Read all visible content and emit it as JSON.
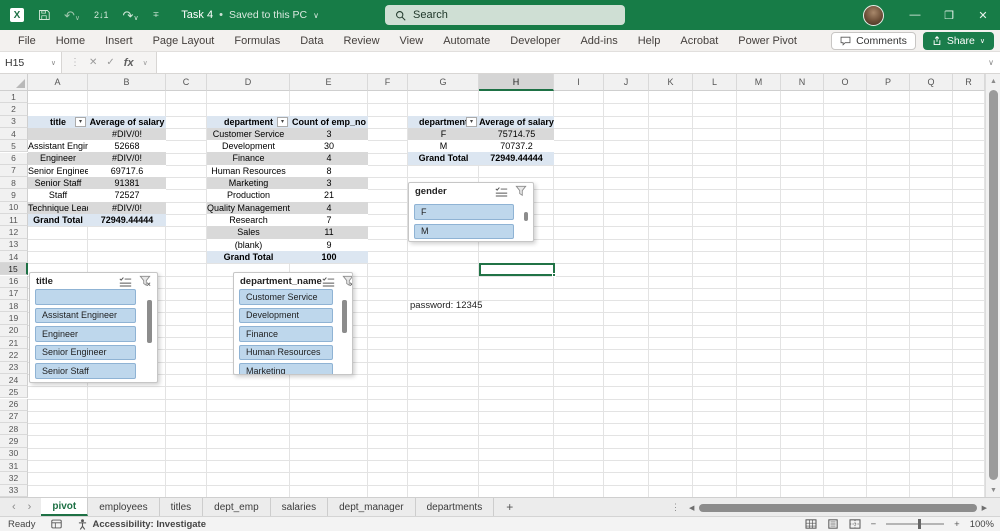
{
  "titlebar": {
    "doc_title": "Task 4",
    "separator": "•",
    "saved_status": "Saved to this PC",
    "search_placeholder": "Search"
  },
  "ribbon": {
    "tabs": [
      "File",
      "Home",
      "Insert",
      "Page Layout",
      "Formulas",
      "Data",
      "Review",
      "View",
      "Automate",
      "Developer",
      "Add-ins",
      "Help",
      "Acrobat",
      "Power Pivot"
    ],
    "comments_label": "Comments",
    "share_label": "Share"
  },
  "formula_bar": {
    "name_box": "H15",
    "fx_label": "fx"
  },
  "grid": {
    "columns": [
      "A",
      "B",
      "C",
      "D",
      "E",
      "F",
      "G",
      "H",
      "I",
      "J",
      "K",
      "L",
      "M",
      "N",
      "O",
      "P",
      "Q",
      "R"
    ],
    "rows": [
      "1",
      "2",
      "3",
      "4",
      "5",
      "6",
      "7",
      "8",
      "9",
      "10",
      "11",
      "12",
      "13",
      "14",
      "15",
      "16",
      "17",
      "18",
      "19",
      "20",
      "21",
      "22",
      "23",
      "24",
      "25",
      "26",
      "27",
      "28",
      "29",
      "30",
      "31",
      "32",
      "33"
    ],
    "selected_cell": "H15",
    "selected_column": "H",
    "selected_row": "15"
  },
  "pivots": [
    {
      "col_headers": [
        "title",
        "Average of salary"
      ],
      "rows": [
        [
          "",
          "#DIV/0!"
        ],
        [
          "Assistant Engineer",
          "52668"
        ],
        [
          "Engineer",
          "#DIV/0!"
        ],
        [
          "Senior Engineer",
          "69717.6"
        ],
        [
          "Senior Staff",
          "91381"
        ],
        [
          "Staff",
          "72527"
        ],
        [
          "Technique Leader",
          "#DIV/0!"
        ]
      ],
      "grand_total": [
        "Grand Total",
        "72949.44444"
      ]
    },
    {
      "col_headers": [
        "department",
        "Count of emp_no"
      ],
      "rows": [
        [
          "Customer Service",
          "3"
        ],
        [
          "Development",
          "30"
        ],
        [
          "Finance",
          "4"
        ],
        [
          "Human Resources",
          "8"
        ],
        [
          "Marketing",
          "3"
        ],
        [
          "Production",
          "21"
        ],
        [
          "Quality Management",
          "4"
        ],
        [
          "Research",
          "7"
        ],
        [
          "Sales",
          "11"
        ],
        [
          "(blank)",
          "9"
        ]
      ],
      "grand_total": [
        "Grand Total",
        "100"
      ]
    },
    {
      "col_headers": [
        "department",
        "Average of salary"
      ],
      "rows": [
        [
          "F",
          "75714.75"
        ],
        [
          "M",
          "70737.2"
        ]
      ],
      "grand_total": [
        "Grand Total",
        "72949.44444"
      ]
    }
  ],
  "slicers": [
    {
      "title": "gender",
      "items": [
        "F",
        "M"
      ]
    },
    {
      "title": "title",
      "items": [
        "",
        "Assistant Engineer",
        "Engineer",
        "Senior Engineer",
        "Senior Staff"
      ]
    },
    {
      "title": "department_name",
      "items": [
        "Customer Service",
        "Development",
        "Finance",
        "Human Resources",
        "Marketing"
      ]
    }
  ],
  "note": {
    "text": "password: 12345"
  },
  "sheet_tabs": {
    "tabs": [
      "pivot",
      "employees",
      "titles",
      "dept_emp",
      "salaries",
      "dept_manager",
      "departments"
    ],
    "active_tab": "pivot",
    "add_label": "+"
  },
  "status_bar": {
    "mode": "Ready",
    "accessibility": "Accessibility: Investigate",
    "zoom_level": "100%"
  }
}
